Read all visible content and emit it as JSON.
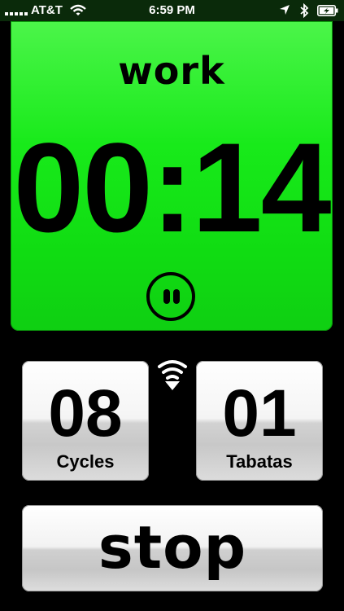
{
  "status_bar": {
    "carrier": "AT&T",
    "time": "6:59 PM"
  },
  "timer": {
    "phase": "work",
    "time": "00:14",
    "panel_color": "#14e416"
  },
  "counters": {
    "cycles": {
      "value": "08",
      "label": "Cycles"
    },
    "tabatas": {
      "value": "01",
      "label": "Tabatas"
    }
  },
  "controls": {
    "pause_icon": "pause-icon",
    "sound_icon": "sound-icon",
    "stop_label": "stop"
  }
}
